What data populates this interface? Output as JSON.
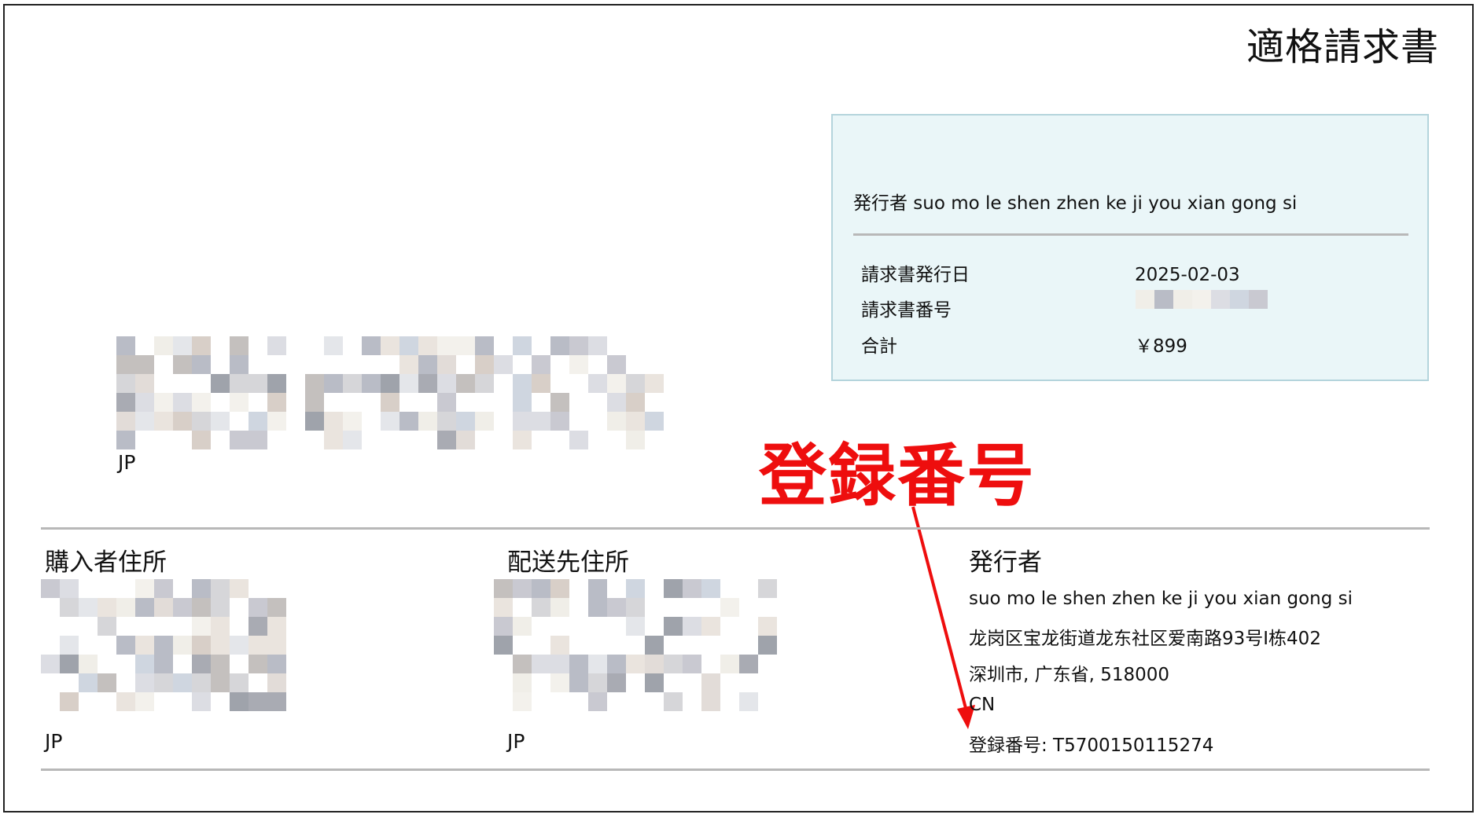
{
  "document": {
    "title": "適格請求書"
  },
  "summary": {
    "issuer_line": "発行者 suo mo le shen zhen ke ji you xian gong si",
    "rows": [
      {
        "label": "請求書発行日",
        "value": "2025-02-03"
      },
      {
        "label": "請求書番号",
        "value": ""
      },
      {
        "label": "合計",
        "value": "￥899"
      }
    ]
  },
  "buyer_block": {
    "country": "JP"
  },
  "annotation": {
    "label": "登録番号",
    "color": "#ee0e0e"
  },
  "columns": {
    "purchaser": {
      "heading": "購入者住所",
      "country": "JP"
    },
    "shipping": {
      "heading": "配送先住所",
      "country": "JP"
    },
    "issuer": {
      "heading": "発行者",
      "lines": [
        "suo mo le shen zhen ke ji you xian gong si",
        "龙岗区宝龙街道龙东社区爱南路93号I栋402",
        "深圳市, 广东省, 518000",
        "CN",
        "登録番号: T5700150115274"
      ]
    }
  },
  "colors": {
    "summary_bg": "#eaf6f8",
    "summary_border": "#b4d4dc",
    "divider": "#b8b8b8",
    "accent_red": "#ee0e0e"
  }
}
